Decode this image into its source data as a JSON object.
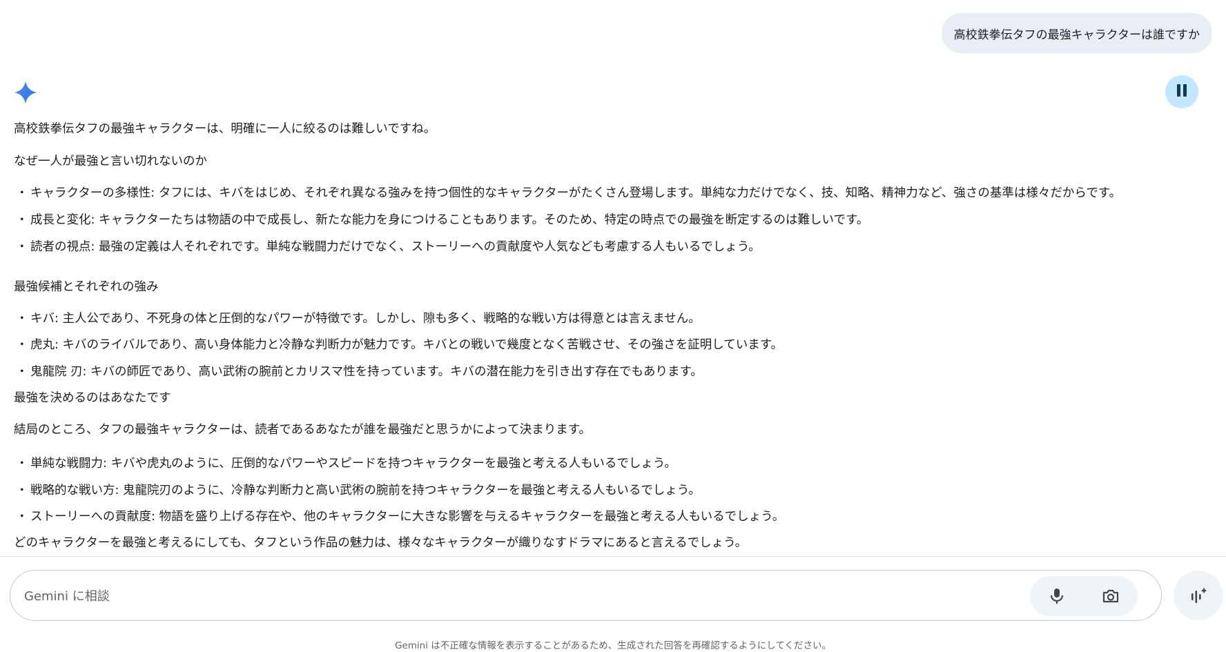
{
  "user_message": "高校鉄拳伝タフの最強キャラクターは誰ですか",
  "response": {
    "intro": "高校鉄拳伝タフの最強キャラクターは、明確に一人に絞るのは難しいですね。",
    "section1_heading": "なぜ一人が最強と言い切れないのか",
    "section1_items": [
      "キャラクターの多様性: タフには、キバをはじめ、それぞれ異なる強みを持つ個性的なキャラクターがたくさん登場します。単純な力だけでなく、技、知略、精神力など、強さの基準は様々だからです。",
      "成長と変化: キャラクターたちは物語の中で成長し、新たな能力を身につけることもあります。そのため、特定の時点での最強を断定するのは難しいです。",
      "読者の視点: 最強の定義は人それぞれです。単純な戦闘力だけでなく、ストーリーへの貢献度や人気なども考慮する人もいるでしょう。"
    ],
    "section2_heading": "最強候補とそれぞれの強み",
    "section2_items": [
      "キバ: 主人公であり、不死身の体と圧倒的なパワーが特徴です。しかし、隙も多く、戦略的な戦い方は得意とは言えません。",
      "虎丸: キバのライバルであり、高い身体能力と冷静な判断力が魅力です。キバとの戦いで幾度となく苦戦させ、その強さを証明しています。",
      "鬼龍院 刃: キバの師匠であり、高い武術の腕前とカリスマ性を持っています。キバの潜在能力を引き出す存在でもあります。"
    ],
    "section3_heading": "最強を決めるのはあなたです",
    "section3_intro": "結局のところ、タフの最強キャラクターは、読者であるあなたが誰を最強だと思うかによって決まります。",
    "section3_items": [
      "単純な戦闘力: キバや虎丸のように、圧倒的なパワーやスピードを持つキャラクターを最強と考える人もいるでしょう。",
      "戦略的な戦い方: 鬼龍院刃のように、冷静な判断力と高い武術の腕前を持つキャラクターを最強と考える人もいるでしょう。",
      "ストーリーへの貢献度: 物語を盛り上げる存在や、他のキャラクターに大きな影響を与えるキャラクターを最強と考える人もいるでしょう。"
    ],
    "conclusion": "どのキャラクターを最強と考えるにしても、タフという作品の魅力は、様々なキャラクターが織りなすドラマにあると言えるでしょう。"
  },
  "input": {
    "placeholder": "Gemini に相談",
    "value": ""
  },
  "icons": {
    "assistant": "gemini-sparkle-icon",
    "stop": "pause-icon",
    "mic": "microphone-icon",
    "camera": "camera-icon",
    "live": "live-voice-icon"
  },
  "bullet_char": "・",
  "disclaimer": "Gemini は不正確な情報を表示することがあるため、生成された回答を再確認するようにしてください。",
  "colors": {
    "user_bubble": "#e9eef6",
    "stop_button": "#c2e7ff",
    "action_pill": "#f0f4f9"
  }
}
